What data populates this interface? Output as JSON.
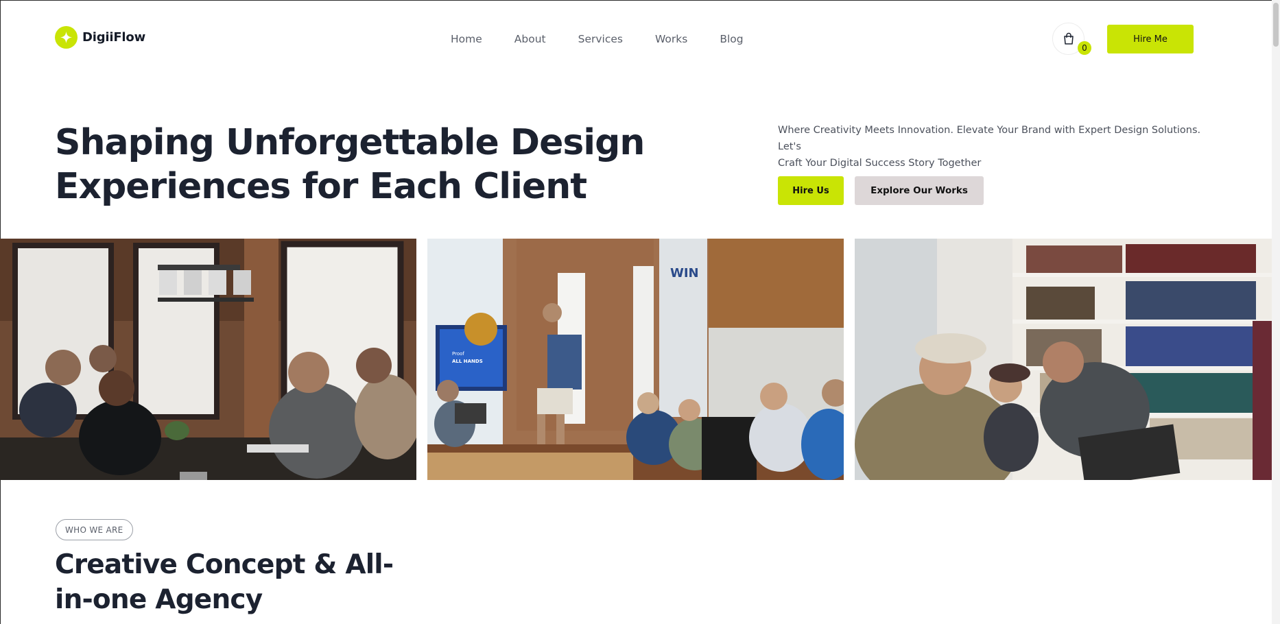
{
  "header": {
    "brand": "DigiiFlow",
    "nav": [
      "Home",
      "About",
      "Services",
      "Works",
      "Blog"
    ],
    "cart_count": "0",
    "hire_me_label": "Hire Me"
  },
  "hero": {
    "title_line1": "Shaping Unforgettable Design",
    "title_line2": "Experiences for Each Client",
    "subtitle_line1": "Where Creativity Meets Innovation. Elevate Your Brand with Expert Design Solutions. Let's",
    "subtitle_line2": "Craft Your Digital Success Story Together",
    "hire_us_label": "Hire Us",
    "explore_label": "Explore Our Works"
  },
  "gallery": {
    "photos": [
      {
        "icon": "team-meeting-photo"
      },
      {
        "icon": "presentation-photo"
      },
      {
        "icon": "team-laughing-photo"
      }
    ],
    "slide_text": {
      "line1": "Proof",
      "line2": "ALL HANDS"
    },
    "wall_sign": "WIN"
  },
  "about": {
    "badge": "WHO WE ARE",
    "title_line1": "Creative Concept & All-",
    "title_line2": "in-one Agency"
  },
  "colors": {
    "accent": "#c9e405",
    "text_dark": "#1c2230",
    "secondary_button": "#ddd7d8"
  }
}
